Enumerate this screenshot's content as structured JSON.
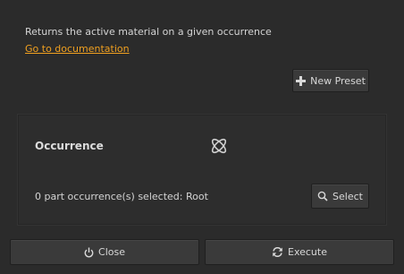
{
  "description": "Returns the active material on a given occurrence",
  "doc_link": "Go to documentation",
  "toolbar": {
    "new_preset_label": "New Preset",
    "new_preset_icon": "plus-icon"
  },
  "occurrence_panel": {
    "title": "Occurrence",
    "icon": "occurrence-icon",
    "selection_status": "0 part occurrence(s) selected: Root",
    "select_label": "Select",
    "select_icon": "search-icon"
  },
  "footer": {
    "close_label": "Close",
    "close_icon": "power-icon",
    "execute_label": "Execute",
    "execute_icon": "refresh-icon"
  },
  "colors": {
    "background": "#2b2b2b",
    "link": "#f0a020",
    "button": "#3a3a3a",
    "text": "#d6d6d6"
  }
}
